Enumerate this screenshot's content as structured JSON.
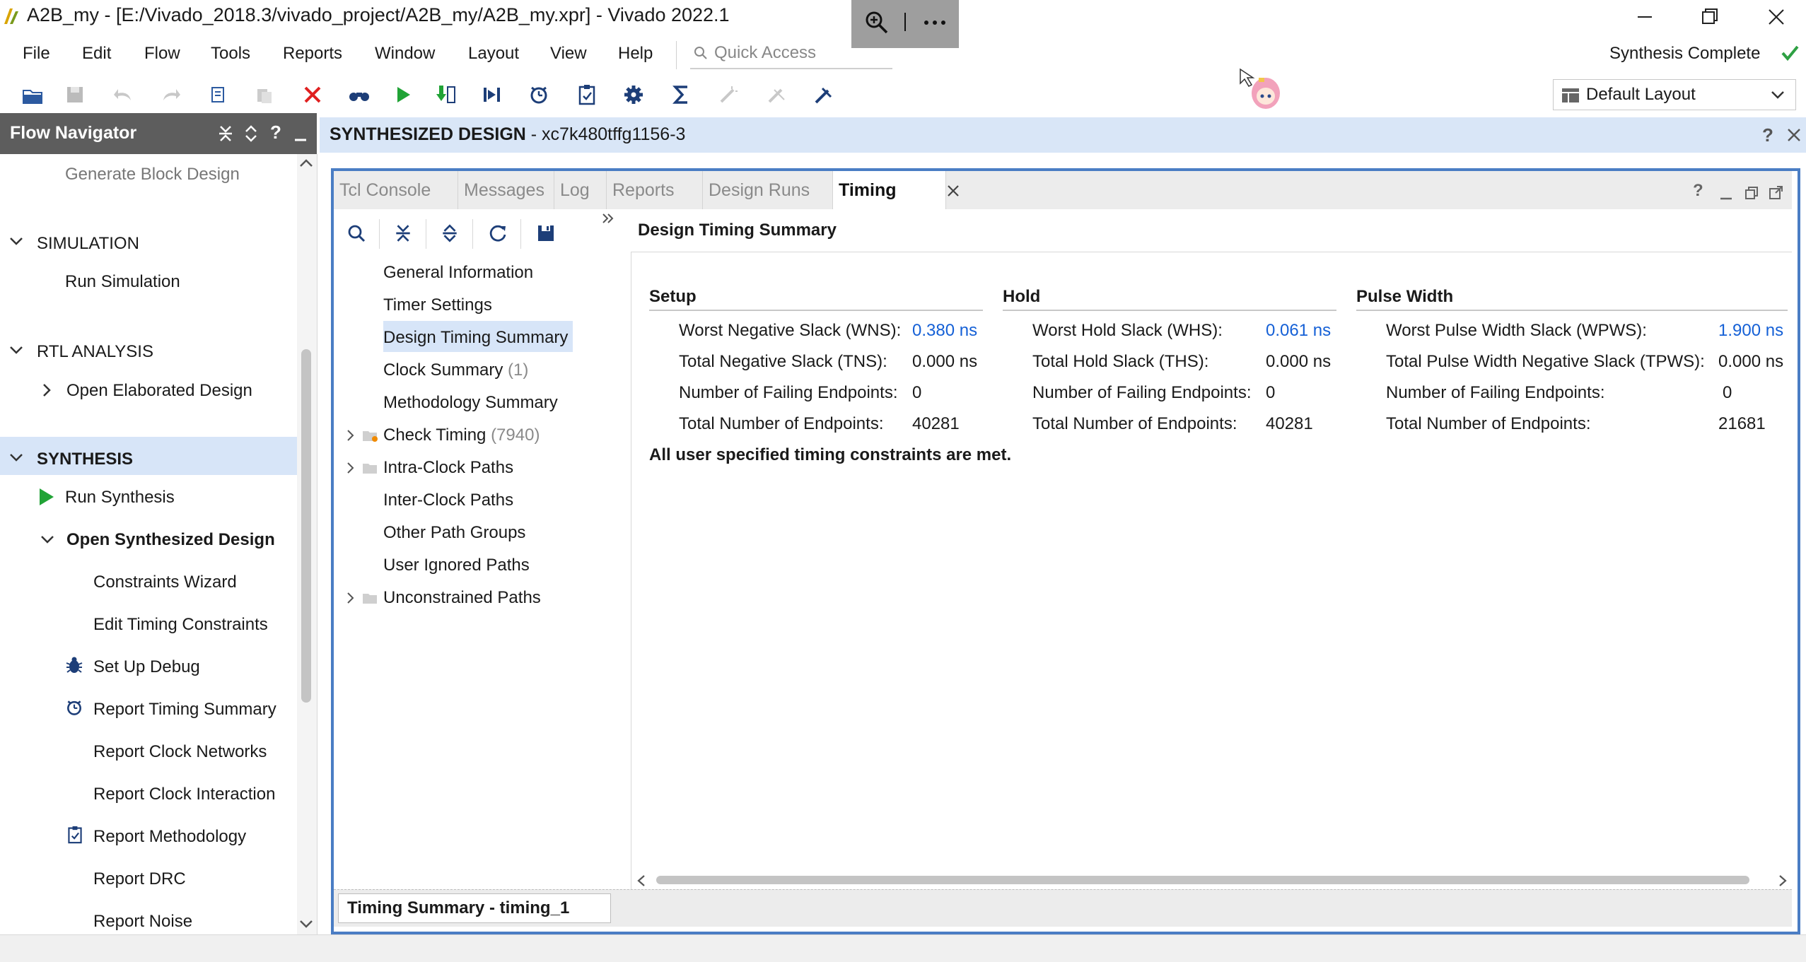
{
  "window": {
    "title": "A2B_my - [E:/Vivado_2018.3/vivado_project/A2B_my/A2B_my.xpr] - Vivado 2022.1",
    "controls": [
      "minimize-icon",
      "restore-icon",
      "close-icon"
    ]
  },
  "overlay": {
    "icons": [
      "zoom-in-icon",
      "more-icon"
    ]
  },
  "menu": [
    "File",
    "Edit",
    "Flow",
    "Tools",
    "Reports",
    "Window",
    "Layout",
    "View",
    "Help"
  ],
  "quick_access": {
    "placeholder": "Quick Access"
  },
  "status": {
    "text": "Synthesis Complete",
    "color": "#2ea043"
  },
  "layout": {
    "selected": "Default Layout"
  },
  "flow_navigator": {
    "title": "Flow Navigator",
    "items": {
      "generate_block_design": "Generate Block Design",
      "simulation": "SIMULATION",
      "run_simulation": "Run Simulation",
      "rtl_analysis": "RTL ANALYSIS",
      "open_elaborated_design": "Open Elaborated Design",
      "synthesis": "SYNTHESIS",
      "run_synthesis": "Run Synthesis",
      "open_synthesized_design": "Open Synthesized Design",
      "constraints_wizard": "Constraints Wizard",
      "edit_timing_constraints": "Edit Timing Constraints",
      "set_up_debug": "Set Up Debug",
      "report_timing_summary": "Report Timing Summary",
      "report_clock_networks": "Report Clock Networks",
      "report_clock_interaction": "Report Clock Interaction",
      "report_methodology": "Report Methodology",
      "report_drc": "Report DRC",
      "report_noise": "Report Noise"
    }
  },
  "design_header": {
    "label": "SYNTHESIZED DESIGN",
    "part": " - xc7k480tffg1156-3"
  },
  "tabs": [
    "Tcl Console",
    "Messages",
    "Log",
    "Reports",
    "Design Runs",
    "Timing"
  ],
  "tree": [
    {
      "label": "General Information",
      "count": ""
    },
    {
      "label": "Timer Settings",
      "count": ""
    },
    {
      "label": "Design Timing Summary",
      "count": ""
    },
    {
      "label": "Clock Summary",
      "count": "(1)"
    },
    {
      "label": "Methodology Summary",
      "count": ""
    },
    {
      "label": "Check Timing",
      "count": "(7940)"
    },
    {
      "label": "Intra-Clock Paths",
      "count": ""
    },
    {
      "label": "Inter-Clock Paths",
      "count": ""
    },
    {
      "label": "Other Path Groups",
      "count": ""
    },
    {
      "label": "User Ignored Paths",
      "count": ""
    },
    {
      "label": "Unconstrained Paths",
      "count": ""
    }
  ],
  "summary": {
    "title": "Design Timing Summary",
    "setup": {
      "heading": "Setup",
      "rows": [
        {
          "label": "Worst Negative Slack (WNS):",
          "value": "0.380 ns"
        },
        {
          "label": "Total Negative Slack (TNS):",
          "value": "0.000 ns"
        },
        {
          "label": "Number of Failing Endpoints:",
          "value": "0"
        },
        {
          "label": "Total Number of Endpoints:",
          "value": "40281"
        }
      ]
    },
    "hold": {
      "heading": "Hold",
      "rows": [
        {
          "label": "Worst Hold Slack (WHS):",
          "value": "0.061 ns"
        },
        {
          "label": "Total Hold Slack (THS):",
          "value": "0.000 ns"
        },
        {
          "label": "Number of Failing Endpoints:",
          "value": "0"
        },
        {
          "label": "Total Number of Endpoints:",
          "value": "40281"
        }
      ]
    },
    "pulse": {
      "heading": "Pulse Width",
      "rows": [
        {
          "label": "Worst Pulse Width Slack (WPWS):",
          "value": "1.900 ns"
        },
        {
          "label": "Total Pulse Width Negative Slack (TPWS):",
          "value": "0.000 ns"
        },
        {
          "label": "Number of Failing Endpoints:",
          "value": "0"
        },
        {
          "label": "Total Number of Endpoints:",
          "value": "21681"
        }
      ]
    },
    "footer": "All user specified timing constraints are met."
  },
  "bottom_tab": "Timing Summary - timing_1",
  "colors": {
    "accent": "#4a7dc4",
    "link": "#1560d6",
    "selection": "#d7e5f8",
    "run_green": "#21a336",
    "delete_red": "#e02020"
  }
}
